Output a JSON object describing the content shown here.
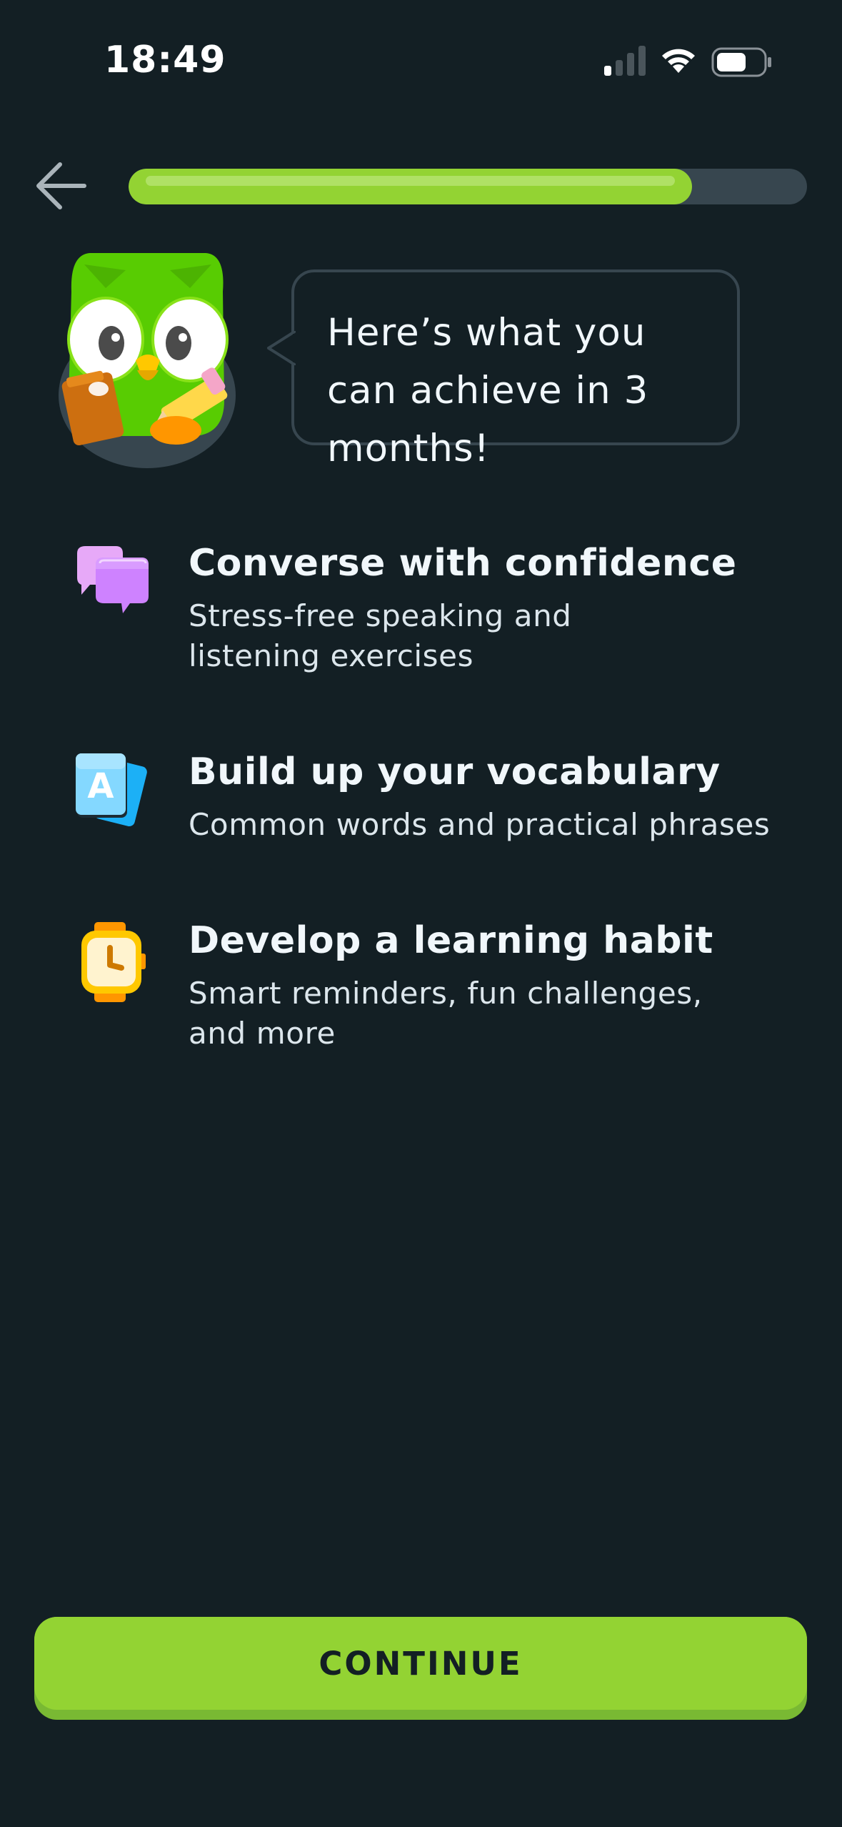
{
  "status_bar": {
    "time": "18:49",
    "icons": [
      "cellular-signal-icon",
      "wifi-icon",
      "battery-icon"
    ]
  },
  "nav": {
    "back_icon": "arrow-left-icon",
    "progress_fraction": 0.83
  },
  "mascot": {
    "icon": "owl-mascot-icon",
    "speech": "Here’s what you can achieve in 3 months!"
  },
  "features": [
    {
      "icon": "chat-bubbles-icon",
      "title": "Converse with confidence",
      "description": "Stress-free speaking and listening exercises"
    },
    {
      "icon": "flashcards-icon",
      "title": "Build up your vocabulary",
      "description": "Common words and practical phrases"
    },
    {
      "icon": "watch-icon",
      "title": "Develop a learning habit",
      "description": "Smart reminders, fun challenges, and more"
    }
  ],
  "continue_label": "CONTINUE",
  "colors": {
    "background": "#131f24",
    "accent": "#93d333",
    "track": "#37464f"
  }
}
